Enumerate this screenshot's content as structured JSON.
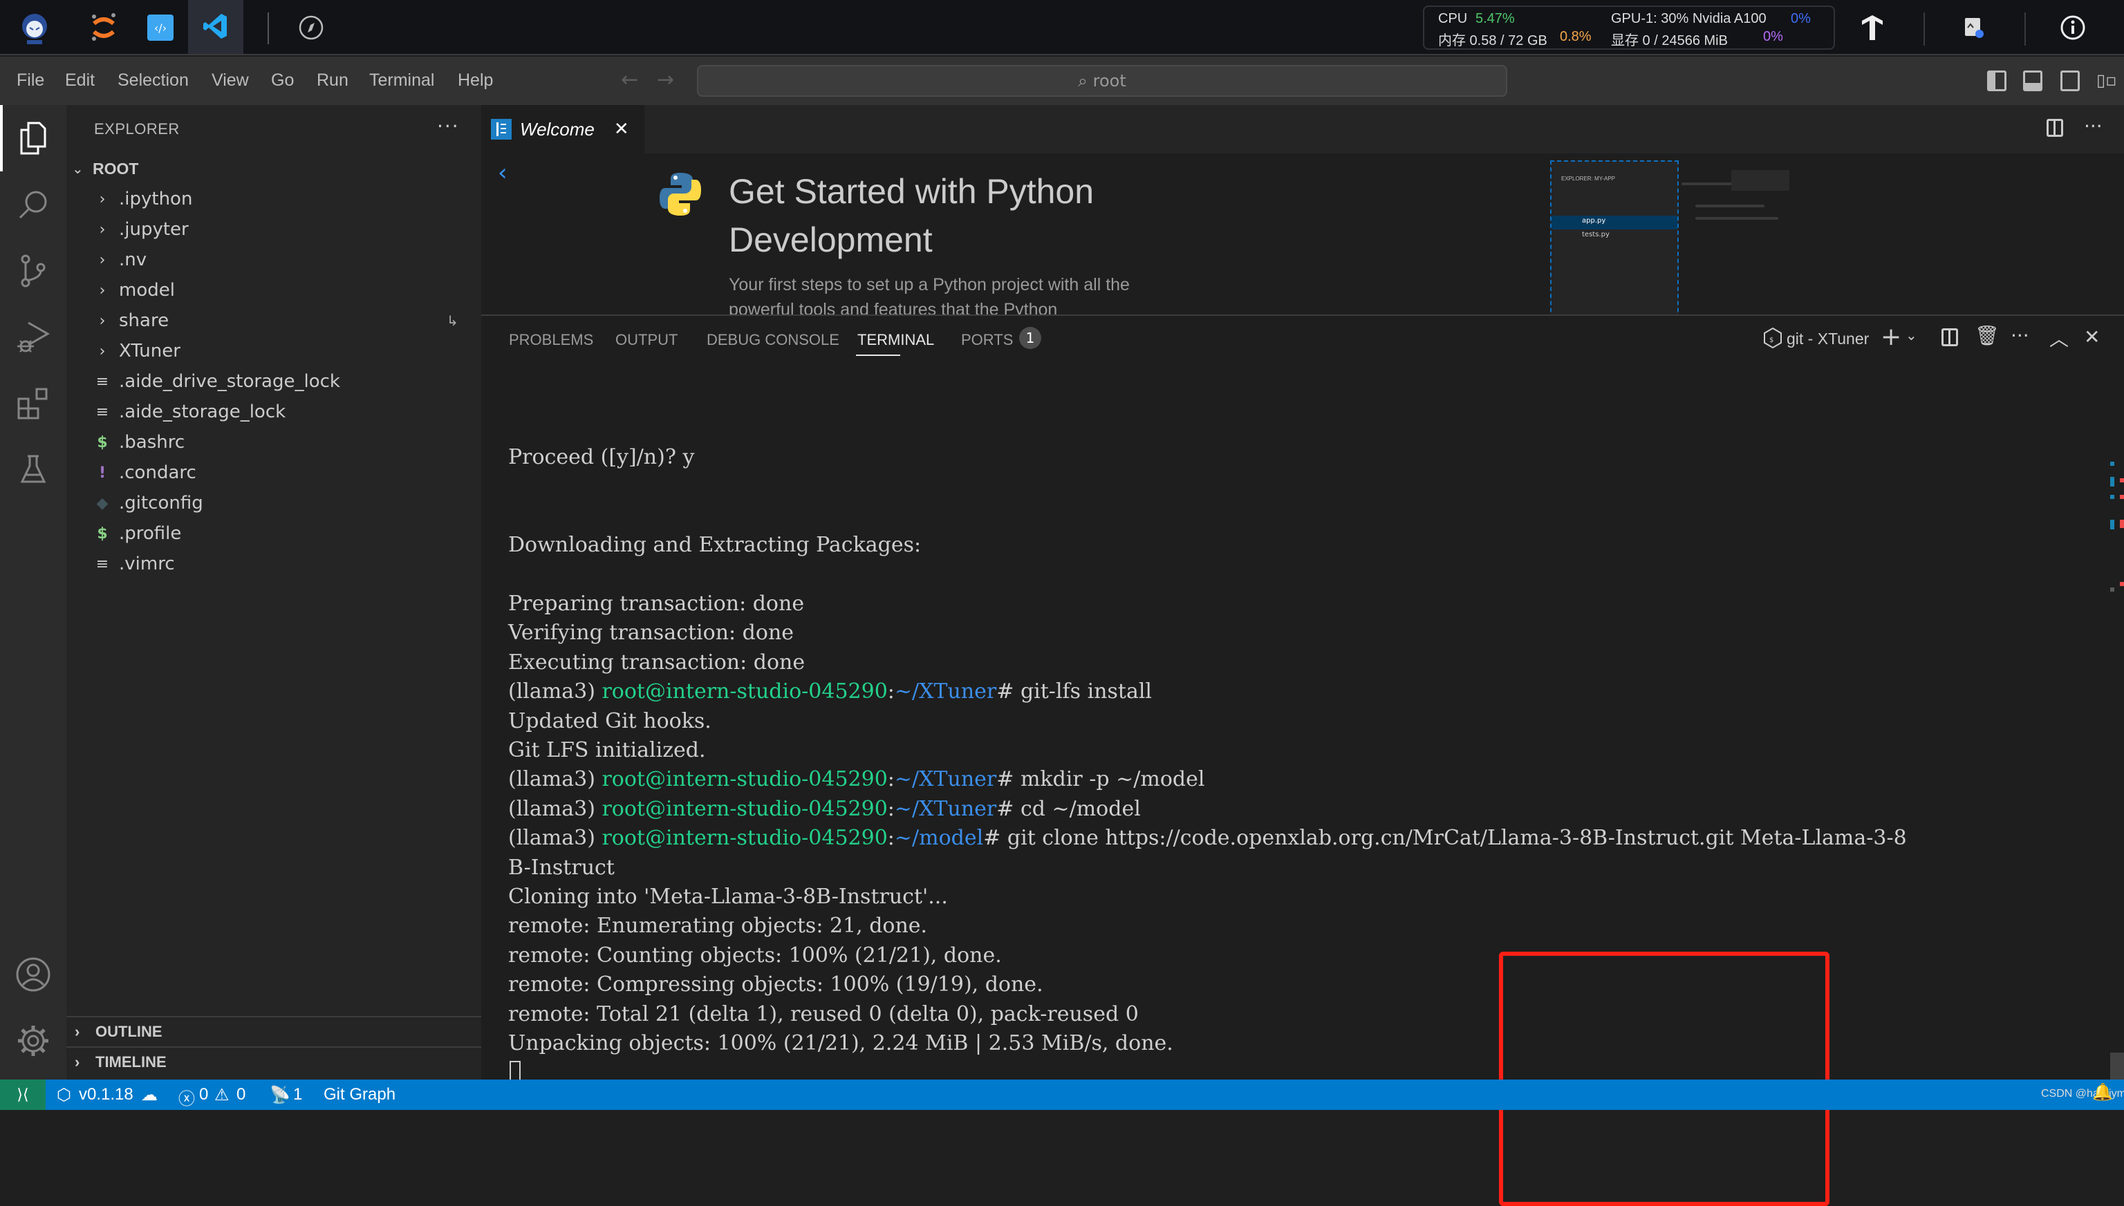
{
  "topbar": {
    "apps": [
      "intern-studio-logo",
      "jupyter",
      "code-server",
      "vscode",
      "compass"
    ],
    "monitor": {
      "cpu_label": "CPU",
      "cpu_value": "5.47%",
      "gpu_label": "GPU-1: 30% Nvidia A100",
      "gpu_value": "0%",
      "mem_label": "内存 0.58 / 72 GB",
      "mem_value": "0.8%",
      "vram_label": "显存 0 / 24566 MiB",
      "vram_value": "0%"
    },
    "colors": {
      "cpu": "#4ec76a",
      "gpu": "#3d6ef5",
      "mem": "#f5a54a",
      "vram": "#b36cf5"
    }
  },
  "menubar": {
    "items": [
      "File",
      "Edit",
      "Selection",
      "View",
      "Go",
      "Run",
      "Terminal",
      "Help"
    ],
    "command_center": "root"
  },
  "sidebar": {
    "title": "EXPLORER",
    "root_label": "ROOT",
    "items": [
      {
        "label": ".ipython",
        "type": "folder"
      },
      {
        "label": ".jupyter",
        "type": "folder"
      },
      {
        "label": ".nv",
        "type": "folder"
      },
      {
        "label": "model",
        "type": "folder"
      },
      {
        "label": "share",
        "type": "folder"
      },
      {
        "label": "XTuner",
        "type": "folder"
      },
      {
        "label": ".aide_drive_storage_lock",
        "type": "text"
      },
      {
        "label": ".aide_storage_lock",
        "type": "text"
      },
      {
        "label": ".bashrc",
        "type": "shell"
      },
      {
        "label": ".condarc",
        "type": "yaml"
      },
      {
        "label": ".gitconfig",
        "type": "git"
      },
      {
        "label": ".profile",
        "type": "shell"
      },
      {
        "label": ".vimrc",
        "type": "text"
      }
    ],
    "outline_label": "OUTLINE",
    "timeline_label": "TIMELINE"
  },
  "editor": {
    "tab_label": "Welcome",
    "title": "Get Started with Python Development",
    "description": "Your first steps to set up a Python project with all the powerful tools and features that the Python",
    "preview": {
      "header": "EXPLORER: MY-APP",
      "files": [
        "app.py",
        "tests.py"
      ]
    }
  },
  "panel": {
    "tabs": [
      "PROBLEMS",
      "OUTPUT",
      "DEBUG CONSOLE",
      "TERMINAL",
      "PORTS"
    ],
    "active_tab": "TERMINAL",
    "ports_badge": "1",
    "terminal_name": "git - XTuner",
    "prompt_env": "(llama3) ",
    "prompt_user": "root@intern-studio-045290",
    "lines": [
      {
        "text": "Proceed ([y]/n)? y"
      },
      {
        "text": ""
      },
      {
        "text": ""
      },
      {
        "text": "Downloading and Extracting Packages:"
      },
      {
        "text": ""
      },
      {
        "text": "Preparing transaction: done"
      },
      {
        "text": "Verifying transaction: done"
      },
      {
        "text": "Executing transaction: done"
      },
      {
        "prompt": true,
        "path": "~/XTuner",
        "cmd": "git-lfs install"
      },
      {
        "text": "Updated Git hooks."
      },
      {
        "text": "Git LFS initialized."
      },
      {
        "prompt": true,
        "path": "~/XTuner",
        "cmd": "mkdir -p ~/model"
      },
      {
        "prompt": true,
        "path": "~/XTuner",
        "cmd": "cd ~/model"
      },
      {
        "prompt": true,
        "path": "~/model",
        "cmd": "git clone https://code.openxlab.org.cn/MrCat/Llama-3-8B-Instruct.git Meta-Llama-3-8"
      },
      {
        "text": "B-Instruct"
      },
      {
        "text": "Cloning into 'Meta-Llama-3-8B-Instruct'..."
      },
      {
        "text": "remote: Enumerating objects: 21, done."
      },
      {
        "text": "remote: Counting objects: 100% (21/21), done."
      },
      {
        "text": "remote: Compressing objects: 100% (19/19), done."
      },
      {
        "text": "remote: Total 21 (delta 1), reused 0 (delta 0), pack-reused 0"
      },
      {
        "text": "Unpacking objects: 100% (21/21), 2.24 MiB | 2.53 MiB/s, done."
      }
    ]
  },
  "statusbar": {
    "version": "v0.1.18",
    "errors": "0",
    "warnings": "0",
    "ports": "1",
    "git_graph": "Git Graph",
    "watermark": "CSDN @hardjym"
  }
}
